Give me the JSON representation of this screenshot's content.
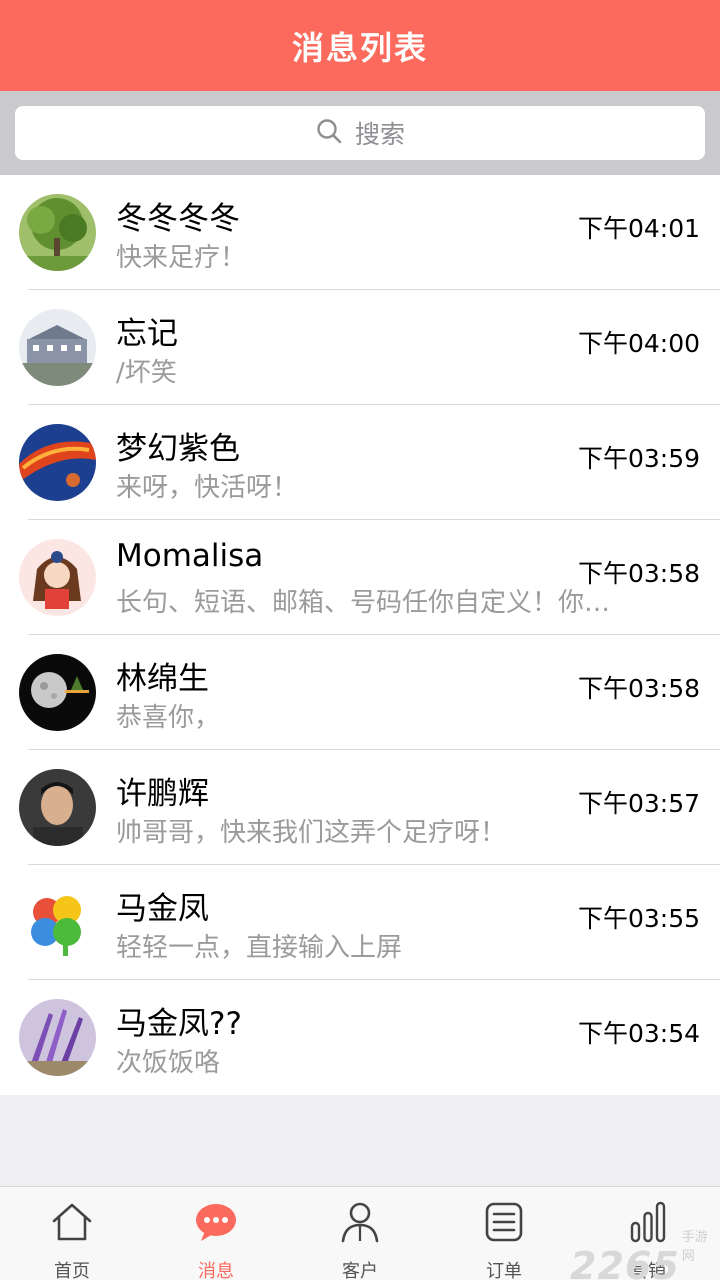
{
  "header": {
    "title": "消息列表"
  },
  "search": {
    "placeholder": "搜索"
  },
  "conversations": [
    {
      "name": "冬冬冬冬",
      "preview": "快来足疗！",
      "time": "下午04:01"
    },
    {
      "name": "忘记",
      "preview": "/坏笑",
      "time": "下午04:00"
    },
    {
      "name": "梦幻紫色",
      "preview": "来呀，快活呀！",
      "time": "下午03:59"
    },
    {
      "name": "Momalisa",
      "preview": "长句、短语、邮箱、号码任你自定义！你…",
      "time": "下午03:58"
    },
    {
      "name": "林绵生",
      "preview": "恭喜你，",
      "time": "下午03:58"
    },
    {
      "name": "许鹏辉",
      "preview": "帅哥哥，快来我们这弄个足疗呀！",
      "time": "下午03:57"
    },
    {
      "name": "马金凤",
      "preview": "轻轻一点，直接输入上屏",
      "time": "下午03:55"
    },
    {
      "name": "马金凤??",
      "preview": "次饭饭咯",
      "time": "下午03:54"
    }
  ],
  "tabbar": {
    "items": [
      {
        "label": "首页",
        "icon": "home-icon"
      },
      {
        "label": "消息",
        "icon": "chat-bubble-icon",
        "active": true
      },
      {
        "label": "客户",
        "icon": "person-icon"
      },
      {
        "label": "订单",
        "icon": "list-icon"
      },
      {
        "label": "营销",
        "icon": "bar-chart-icon"
      }
    ]
  },
  "watermark": {
    "number": "2265",
    "text": "手游网"
  },
  "colors": {
    "accent": "#fb6a5c",
    "search_bg": "#c9c9ce",
    "preview_text": "#9b9b9b"
  }
}
